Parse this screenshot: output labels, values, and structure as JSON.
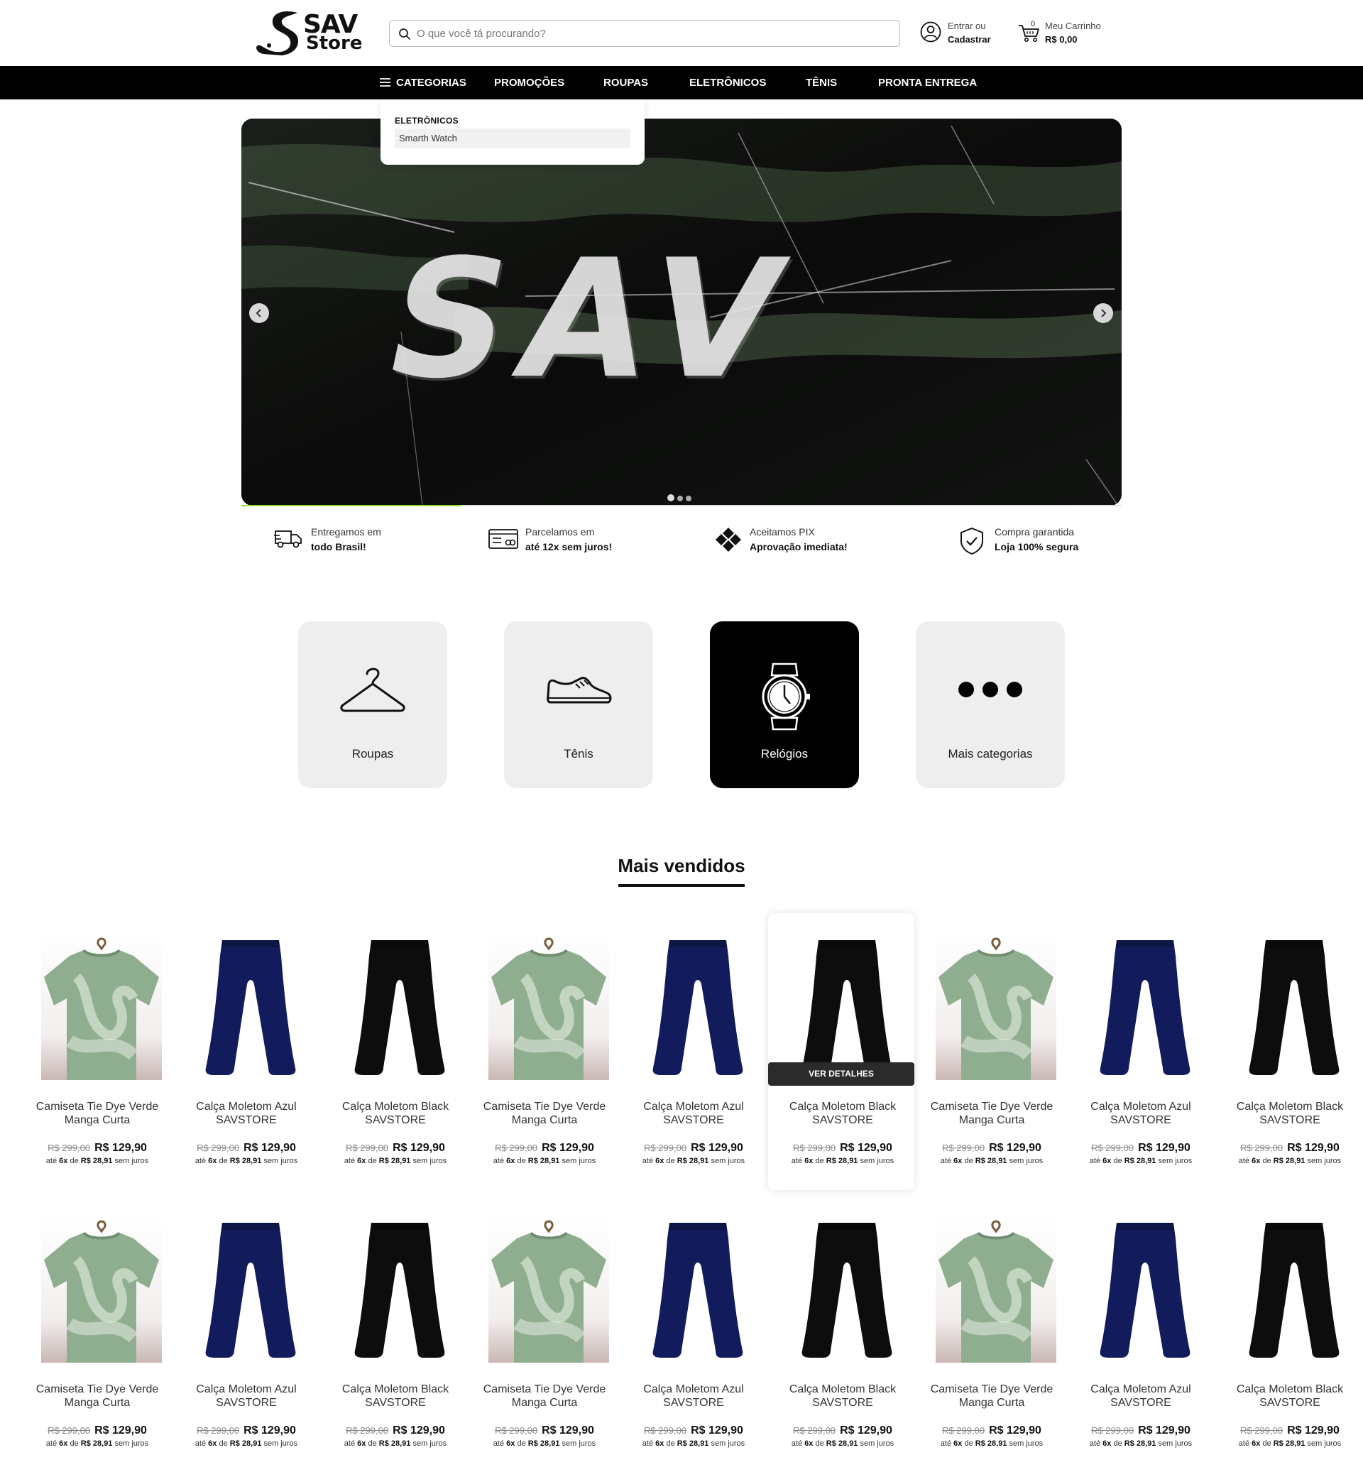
{
  "header": {
    "logo_line1": "SAV",
    "logo_line2": "Store",
    "search_placeholder": "O que você tá procurando?",
    "account_line1": "Entrar ou",
    "account_line2": "Cadastrar",
    "cart_count": "0",
    "cart_label": "Meu Carrinho",
    "cart_total": "R$ 0,00"
  },
  "nav": {
    "categories": "CATEGORIAS",
    "promocoes": "PROMOÇÕES",
    "roupas": "ROUPAS",
    "eletronicos": "ELETRÔNICOS",
    "tenis": "TÊNIS",
    "pronta_entrega": "PRONTA ENTREGA"
  },
  "dropdown": {
    "title": "ELETRÔNICOS",
    "item": "Smarth Watch"
  },
  "banner": {
    "word": "SAV",
    "active_slide": 1,
    "slide_count": 3
  },
  "features": [
    {
      "line1": "Entregamos em",
      "line2": "todo Brasil!",
      "icon": "truck-icon"
    },
    {
      "line1": "Parcelamos em",
      "line2": "até 12x sem juros!",
      "icon": "card-icon"
    },
    {
      "line1": "Aceitamos PIX",
      "line2": "Aprovação imediata!",
      "icon": "pix-icon"
    },
    {
      "line1": "Compra garantida",
      "line2": "Loja 100% segura",
      "icon": "shield-icon"
    }
  ],
  "categories": [
    {
      "label": "Roupas",
      "icon": "hanger-icon"
    },
    {
      "label": "Tênis",
      "icon": "sneaker-icon"
    },
    {
      "label": "Relógios",
      "icon": "watch-icon"
    },
    {
      "label": "Mais categorias",
      "icon": "more-dots-icon"
    }
  ],
  "section_title": "Mais vendidos",
  "product_common": {
    "old_price": "R$ 299,00",
    "new_price": "R$ 129,90",
    "inst_prefix": "até",
    "inst_count": "6x",
    "inst_mid": "de",
    "inst_value": "R$ 28,91",
    "inst_suffix": "sem juros",
    "details_label": "VER DETALHES"
  },
  "products_row1": [
    {
      "line1": "Camiseta Tie Dye Verde",
      "line2": "Manga Curta",
      "kind": "shirt"
    },
    {
      "line1": "Calça Moletom Azul",
      "line2": "SAVSTORE",
      "kind": "pants-blue"
    },
    {
      "line1": "Calça Moletom Black",
      "line2": "SAVSTORE",
      "kind": "pants-black"
    },
    {
      "line1": "Camiseta Tie Dye Verde",
      "line2": "Manga Curta",
      "kind": "shirt"
    },
    {
      "line1": "Calça Moletom Azul",
      "line2": "SAVSTORE",
      "kind": "pants-blue"
    },
    {
      "line1": "Calça Moletom Black",
      "line2": "SAVSTORE",
      "kind": "pants-black"
    },
    {
      "line1": "Camiseta Tie Dye Verde",
      "line2": "Manga Curta",
      "kind": "shirt"
    },
    {
      "line1": "Calça Moletom Azul",
      "line2": "SAVSTORE",
      "kind": "pants-blue"
    },
    {
      "line1": "Calça Moletom Black",
      "line2": "SAVSTORE",
      "kind": "pants-black"
    }
  ],
  "products_row2": [
    {
      "line1": "Camiseta Tie Dye Verde",
      "line2": "Manga Curta",
      "kind": "shirt"
    },
    {
      "line1": "Calça Moletom Azul",
      "line2": "SAVSTORE",
      "kind": "pants-blue"
    },
    {
      "line1": "Calça Moletom Black",
      "line2": "SAVSTORE",
      "kind": "pants-black"
    },
    {
      "line1": "Camiseta Tie Dye Verde",
      "line2": "Manga Curta",
      "kind": "shirt"
    },
    {
      "line1": "Calça Moletom Azul",
      "line2": "SAVSTORE",
      "kind": "pants-blue"
    },
    {
      "line1": "Calça Moletom Black",
      "line2": "SAVSTORE",
      "kind": "pants-black"
    },
    {
      "line1": "Camiseta Tie Dye Verde",
      "line2": "Manga Curta",
      "kind": "shirt"
    },
    {
      "line1": "Calça Moletom Azul",
      "line2": "SAVSTORE",
      "kind": "pants-blue"
    },
    {
      "line1": "Calça Moletom Black",
      "line2": "SAVSTORE",
      "kind": "pants-black"
    }
  ],
  "colors": {
    "accent": "#8ee02b",
    "navbar": "#000000",
    "card_bg": "#efeeee",
    "shirt_green": "#8fae8f",
    "pants_blue": "#121c5c",
    "pants_black": "#0d0d0d"
  }
}
